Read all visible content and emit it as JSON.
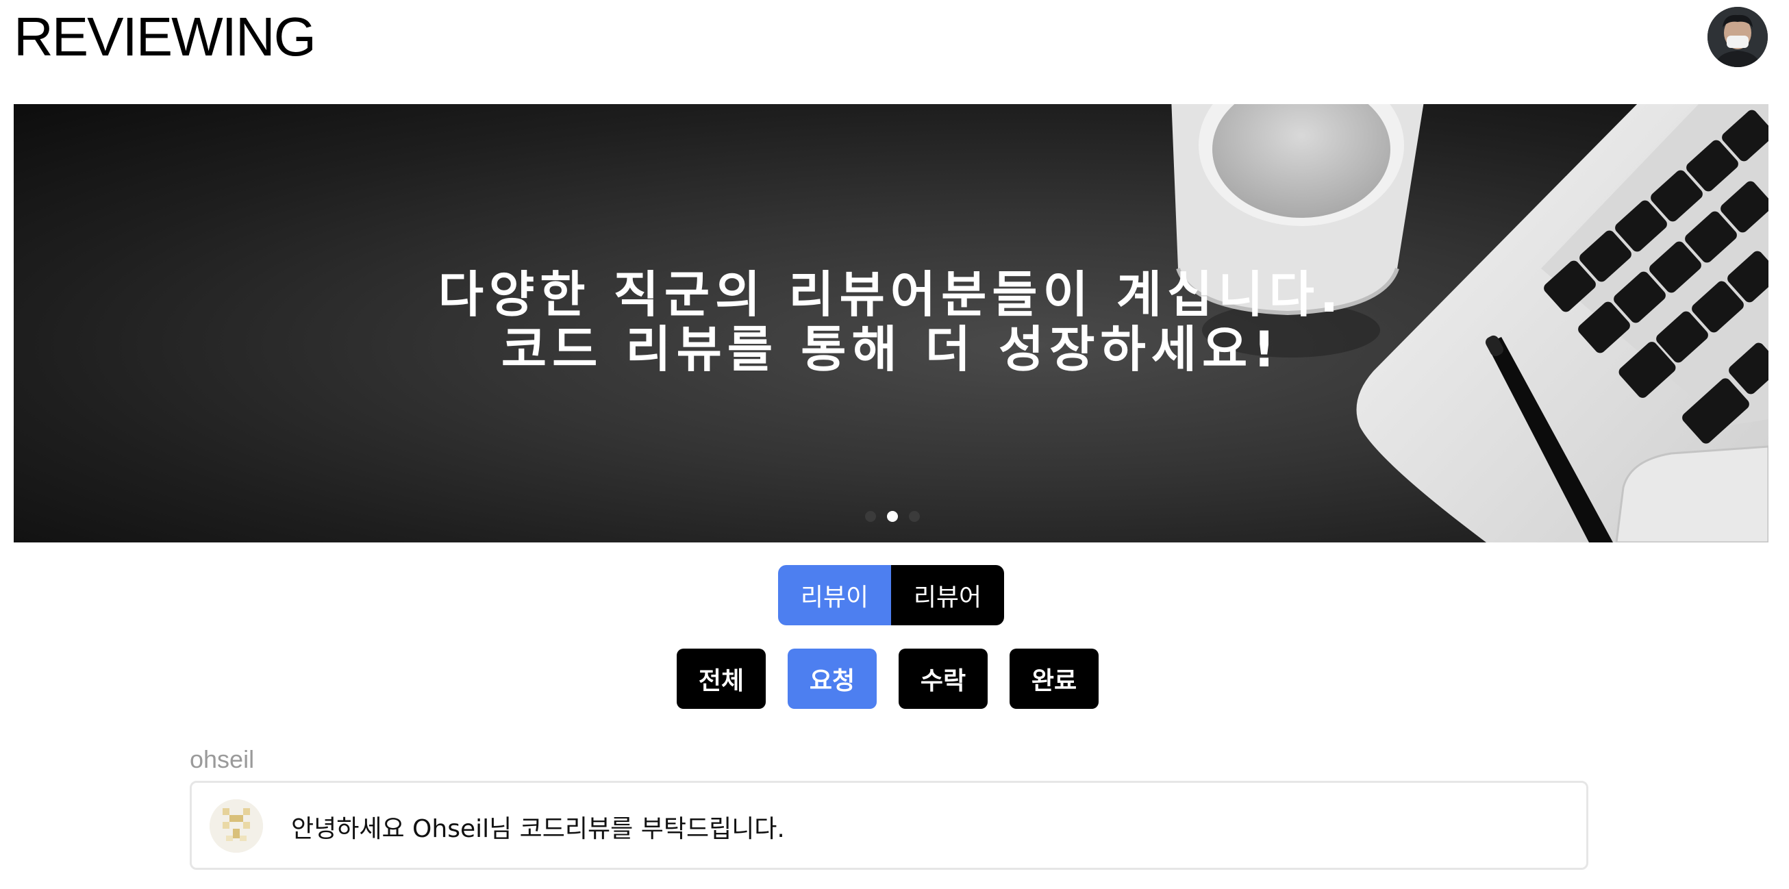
{
  "header": {
    "logo_text": "REVIEWING",
    "profile_avatar_icon": "user-avatar-photo"
  },
  "banner": {
    "line1": "다양한 직군의 리뷰어분들이 계십니다.",
    "line2": "코드 리뷰를 통해 더 성장하세요!",
    "slide_count": 3,
    "active_slide": 2
  },
  "role_toggle": {
    "options": [
      "리뷰이",
      "리뷰어"
    ],
    "selected": "리뷰이"
  },
  "status_filters": {
    "options": [
      "전체",
      "요청",
      "수락",
      "완료"
    ],
    "selected": "요청"
  },
  "review_list": {
    "groups": [
      {
        "username": "ohseil",
        "items": [
          {
            "message": "안녕하세요 Ohseil님 코드리뷰를 부탁드립니다.",
            "avatar_icon": "identicon-avatar"
          }
        ]
      }
    ]
  },
  "colors": {
    "accent": "#4d7ff0",
    "button_dark": "#000000",
    "muted_text": "#9a9a9a",
    "card_border": "#e6e6e6"
  }
}
